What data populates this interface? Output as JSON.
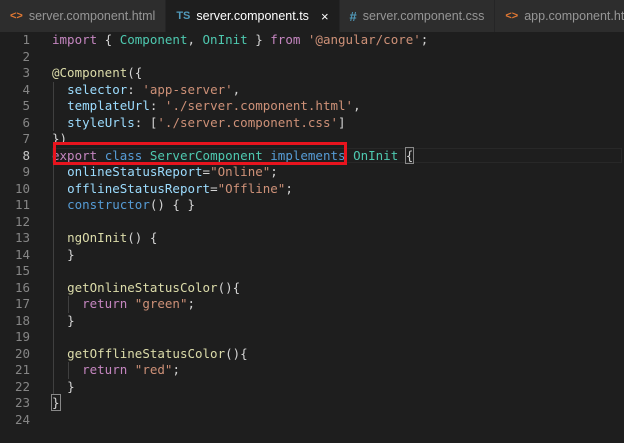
{
  "tabs": [
    {
      "icon": "<>",
      "label": "server.component.html",
      "active": false
    },
    {
      "icon": "TS",
      "label": "server.component.ts",
      "active": true,
      "close": "×"
    },
    {
      "icon": "#",
      "label": "server.component.css",
      "active": false
    },
    {
      "icon": "<>",
      "label": "app.component.html",
      "active": false
    }
  ],
  "code": {
    "line_numbers": [
      "1",
      "2",
      "3",
      "4",
      "5",
      "6",
      "7",
      "8",
      "9",
      "10",
      "11",
      "12",
      "13",
      "14",
      "15",
      "16",
      "17",
      "18",
      "19",
      "20",
      "21",
      "22",
      "23",
      "24"
    ],
    "l1": {
      "kw_import": "import",
      "brace_open": " { ",
      "c1": "Component",
      "comma": ", ",
      "c2": "OnInit",
      "brace_close": " } ",
      "kw_from": "from",
      "sp": " ",
      "module": "'@angular/core'",
      "semi": ";"
    },
    "l3": {
      "decorator": "@Component",
      "open": "({"
    },
    "l4": {
      "key": "selector",
      "colon": ": ",
      "val": "'app-server'",
      "comma": ","
    },
    "l5": {
      "key": "templateUrl",
      "colon": ": ",
      "val": "'./server.component.html'",
      "comma": ","
    },
    "l6": {
      "key": "styleUrls",
      "colon": ": ",
      "open": "[",
      "val": "'./server.component.css'",
      "close": "]"
    },
    "l7": {
      "text": "})"
    },
    "l8": {
      "kw_export": "export",
      "kw_class": "class",
      "name": "ServerComponent",
      "kw_impl": "implements",
      "iface": "OnInit",
      "brace": "{"
    },
    "l9": {
      "key": "onlineStatusReport",
      "eq": "=",
      "val": "\"Online\"",
      "semi": ";"
    },
    "l10": {
      "key": "offlineStatusReport",
      "eq": "=",
      "val": "\"Offline\"",
      "semi": ";"
    },
    "l11": {
      "kw": "constructor",
      "rest": "() { }"
    },
    "l13": {
      "fn": "ngOnInit",
      "rest": "() {"
    },
    "l14": {
      "text": "}"
    },
    "l16": {
      "fn": "getOnlineStatusColor",
      "rest": "(){"
    },
    "l17": {
      "kw": "return",
      "val": "\"green\"",
      "semi": ";"
    },
    "l18": {
      "text": "}"
    },
    "l20": {
      "fn": "getOfflineStatusColor",
      "rest": "(){"
    },
    "l21": {
      "kw": "return",
      "val": "\"red\"",
      "semi": ";"
    },
    "l22": {
      "text": "}"
    },
    "l23": {
      "text": "}"
    }
  },
  "colors": {
    "editor_bg": "#1e1e1e",
    "keyword": "#569cd6",
    "control_keyword": "#c586c0",
    "string": "#ce9178",
    "class": "#4ec9b0",
    "function": "#dcdcaa",
    "property": "#9cdcfe",
    "highlight_box": "#e8141e"
  }
}
